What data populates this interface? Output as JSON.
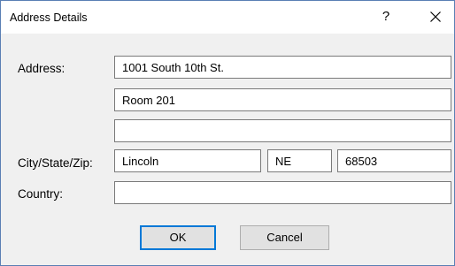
{
  "dialog": {
    "title": "Address Details",
    "help_label": "?",
    "close_icon": "close-icon"
  },
  "form": {
    "address_label": "Address:",
    "address_line1": "1001 South 10th St.",
    "address_line2": "Room 201",
    "address_line3": "",
    "city_state_zip_label": "City/State/Zip:",
    "city": "Lincoln",
    "state": "NE",
    "zip": "68503",
    "country_label": "Country:",
    "country": ""
  },
  "buttons": {
    "ok_label": "OK",
    "cancel_label": "Cancel"
  }
}
